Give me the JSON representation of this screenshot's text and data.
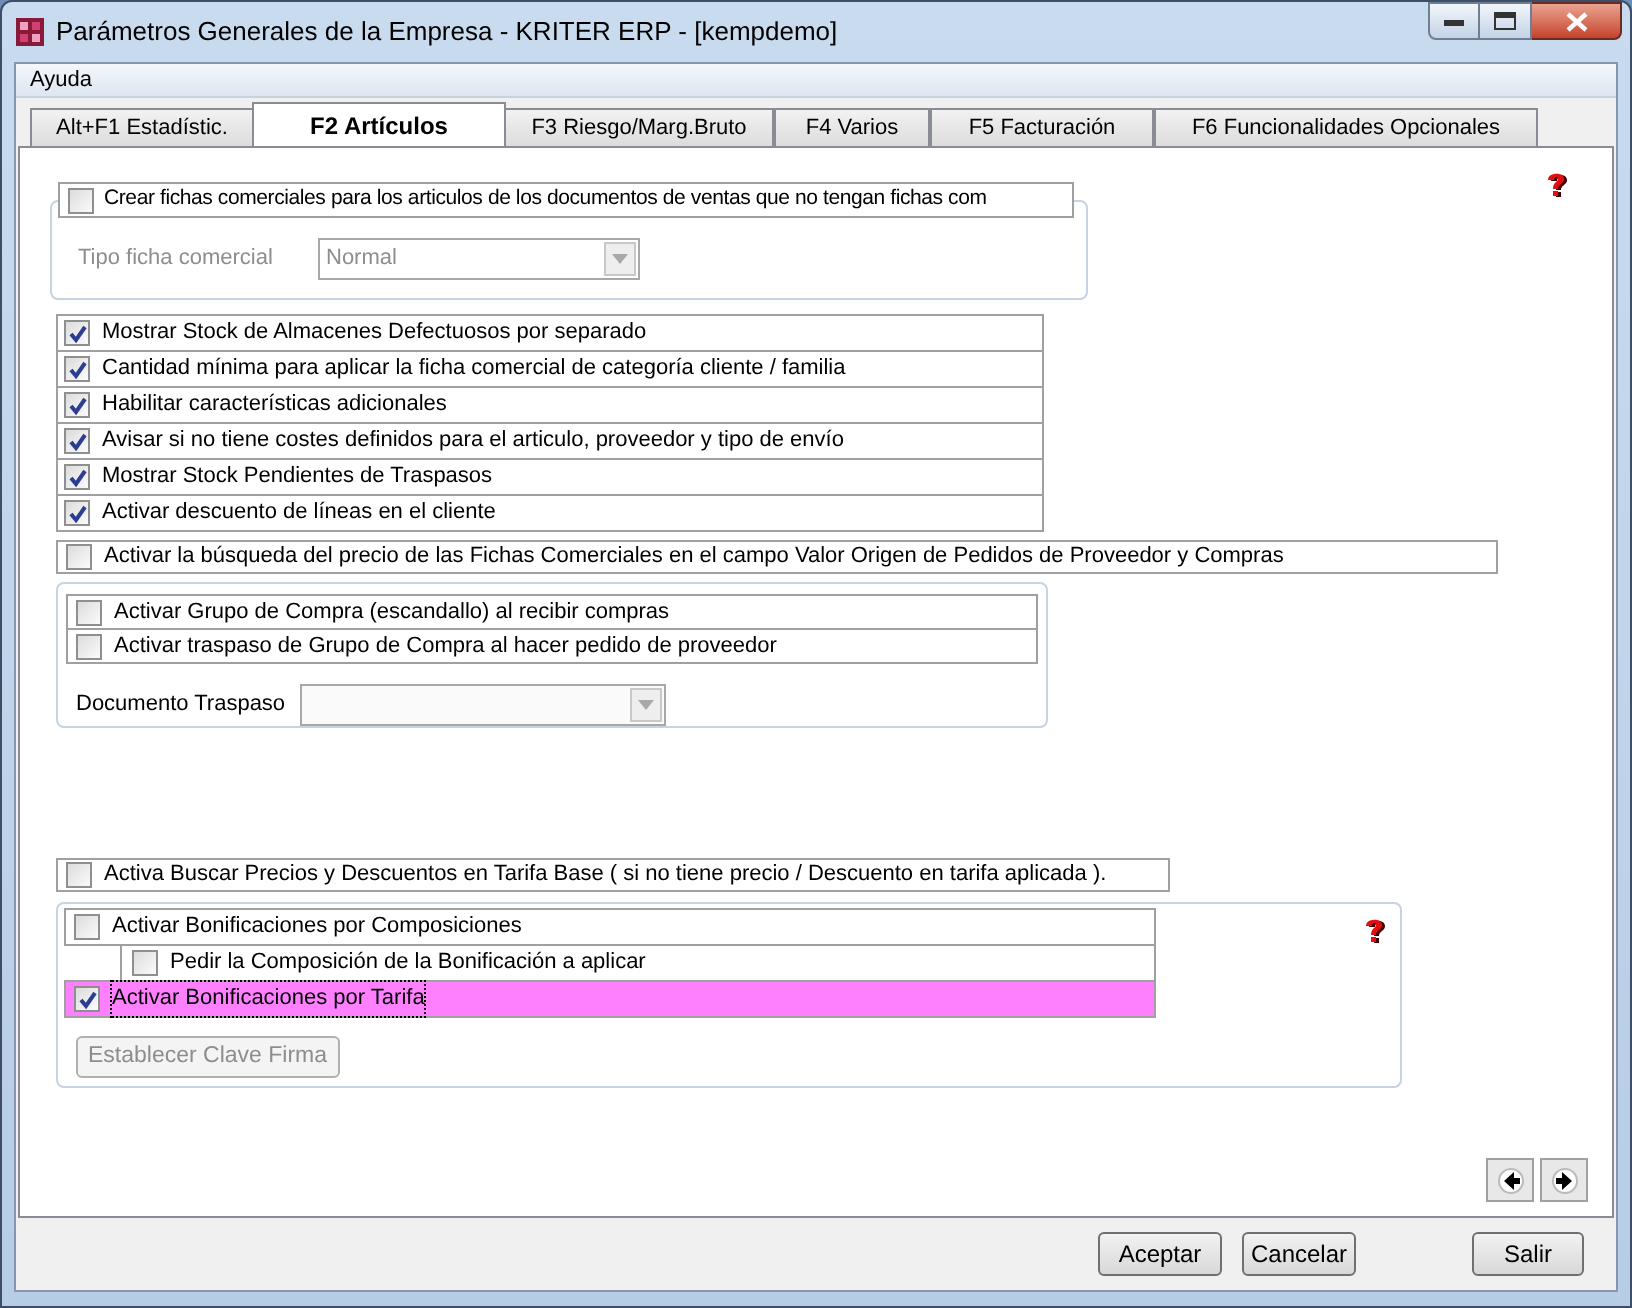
{
  "window": {
    "title": "Parámetros Generales de la Empresa - KRITER ERP - [kempdemo]"
  },
  "menu": [
    "Ayuda"
  ],
  "tabs": [
    {
      "label": "Alt+F1 Estadístic.",
      "selected": false
    },
    {
      "label": "F2 Artículos",
      "selected": true
    },
    {
      "label": "F3 Riesgo/Marg.Bruto",
      "selected": false
    },
    {
      "label": "F4 Varios",
      "selected": false
    },
    {
      "label": "F5 Facturación",
      "selected": false
    },
    {
      "label": "F6 Funcionalidades Opcionales",
      "selected": false
    }
  ],
  "fichas": {
    "checkbox": {
      "label": "Crear fichas comerciales para los articulos de los documentos de ventas que no tengan fichas com",
      "checked": false
    },
    "field": {
      "label": "Tipo ficha comercial",
      "value": "Normal",
      "disabled": true
    }
  },
  "options": [
    {
      "label": "Mostrar Stock de Almacenes Defectuosos por separado",
      "checked": true
    },
    {
      "label": "Cantidad mínima para aplicar la ficha comercial de categoría cliente / familia",
      "checked": true
    },
    {
      "label": "Habilitar características adicionales",
      "checked": true
    },
    {
      "label": "Avisar si no tiene costes definidos para el articulo, proveedor y tipo de envío",
      "checked": true
    },
    {
      "label": "Mostrar Stock Pendientes de Traspasos",
      "checked": true
    },
    {
      "label": "Activar descuento de líneas en el cliente",
      "checked": true
    }
  ],
  "busqueda": {
    "label": "Activar la búsqueda del precio de las Fichas Comerciales en el campo Valor Origen de Pedidos de Proveedor y Compras",
    "checked": false
  },
  "compra": {
    "options": [
      {
        "label": "Activar Grupo de Compra (escandallo) al recibir compras",
        "checked": false
      },
      {
        "label": "Activar traspaso de Grupo de Compra al hacer pedido de proveedor",
        "checked": false
      }
    ],
    "field": {
      "label": "Documento Traspaso",
      "disabled": true
    }
  },
  "tarifa_base": {
    "label": "Activa Buscar Precios y Descuentos en Tarifa Base ( si no tiene precio / Descuento en tarifa aplicada ).",
    "checked": false
  },
  "bonificaciones": {
    "options": [
      {
        "label": "Activar Bonificaciones por Composiciones",
        "checked": false,
        "selected": false,
        "children": [
          {
            "label": "Pedir la Composición de la Bonificación a aplicar",
            "checked": false,
            "selected": false
          }
        ]
      },
      {
        "label": "Activar Bonificaciones por Tarifa",
        "checked": true,
        "selected": true
      }
    ],
    "button": {
      "label": "Establecer Clave Firma",
      "disabled": true
    }
  },
  "buttons": [
    "Aceptar",
    "Cancelar",
    "Salir"
  ]
}
